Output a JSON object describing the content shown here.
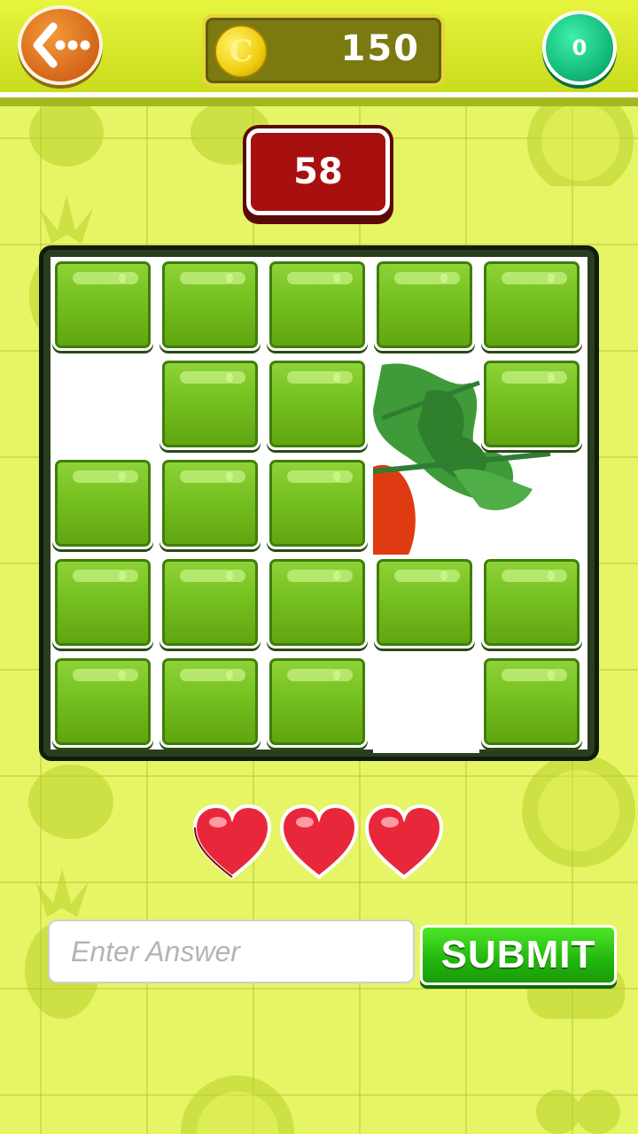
{
  "header": {
    "back_icon": "back-arrow-icon",
    "coin_icon": "coin-icon",
    "coin_symbol": "C",
    "coins": "150",
    "hints": "0"
  },
  "timer": {
    "seconds": "58"
  },
  "board": {
    "rows": 5,
    "cols": 5,
    "hidden_picture": "vegetable-with-leaves"
  },
  "lives": {
    "count": 3,
    "icon": "heart-icon"
  },
  "answer": {
    "placeholder": "Enter Answer",
    "value": "",
    "submit_label": "SUBMIT"
  },
  "colors": {
    "background": "#e6f566",
    "tile": "#76c020",
    "timer": "#a80f0f",
    "submit": "#22b60e"
  }
}
